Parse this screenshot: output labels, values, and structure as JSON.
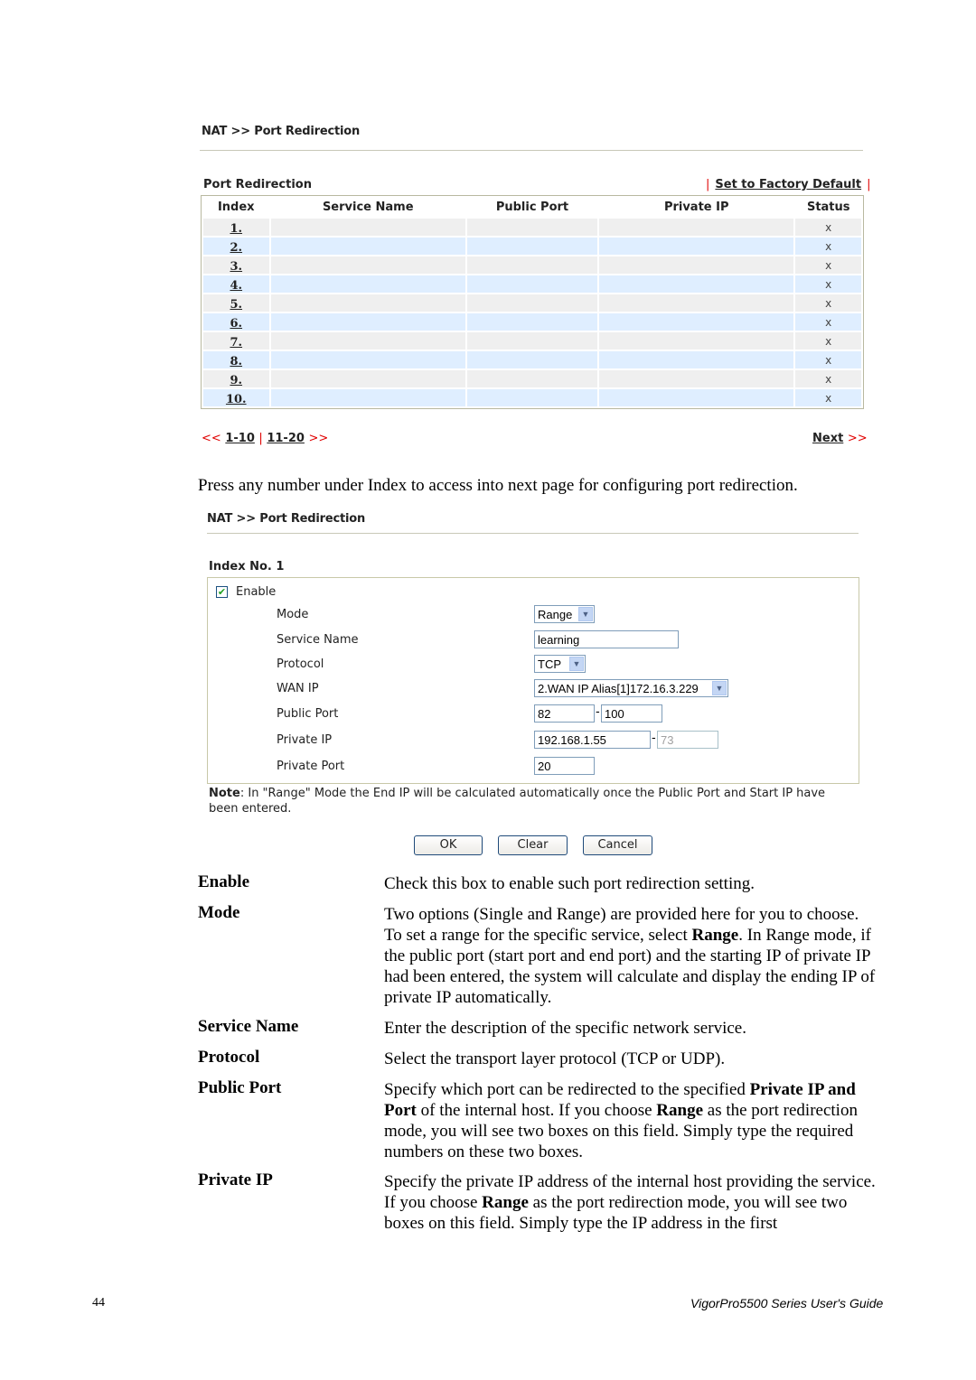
{
  "screen1": {
    "breadcrumb": "NAT >> Port Redirection",
    "section_title": "Port Redirection",
    "factory_default_link": "Set to Factory Default",
    "columns": [
      "Index",
      "Service Name",
      "Public Port",
      "Private IP",
      "Status"
    ],
    "rows": [
      {
        "index": "1.",
        "service_name": "",
        "public_port": "",
        "private_ip": "",
        "status": "x"
      },
      {
        "index": "2.",
        "service_name": "",
        "public_port": "",
        "private_ip": "",
        "status": "x"
      },
      {
        "index": "3.",
        "service_name": "",
        "public_port": "",
        "private_ip": "",
        "status": "x"
      },
      {
        "index": "4.",
        "service_name": "",
        "public_port": "",
        "private_ip": "",
        "status": "x"
      },
      {
        "index": "5.",
        "service_name": "",
        "public_port": "",
        "private_ip": "",
        "status": "x"
      },
      {
        "index": "6.",
        "service_name": "",
        "public_port": "",
        "private_ip": "",
        "status": "x"
      },
      {
        "index": "7.",
        "service_name": "",
        "public_port": "",
        "private_ip": "",
        "status": "x"
      },
      {
        "index": "8.",
        "service_name": "",
        "public_port": "",
        "private_ip": "",
        "status": "x"
      },
      {
        "index": "9.",
        "service_name": "",
        "public_port": "",
        "private_ip": "",
        "status": "x"
      },
      {
        "index": "10.",
        "service_name": "",
        "public_port": "",
        "private_ip": "",
        "status": "x"
      }
    ],
    "pager": {
      "prev": "<<",
      "range1": "1-10",
      "separator": "|",
      "range2": "11-20",
      "next_arrows": ">>",
      "next_label": "Next",
      "next_suffix": ">>"
    }
  },
  "instruction": "Press any number under Index to access into next page for configuring port redirection.",
  "screen2": {
    "breadcrumb": "NAT >> Port Redirection",
    "section_title": "Index No. 1",
    "enable_label": "Enable",
    "enable_checked": true,
    "fields": {
      "mode": {
        "label": "Mode",
        "value": "Range"
      },
      "service_name": {
        "label": "Service Name",
        "value": "learning"
      },
      "protocol": {
        "label": "Protocol",
        "value": "TCP"
      },
      "wan_ip": {
        "label": "WAN IP",
        "value": "2.WAN IP Alias[1]172.16.3.229"
      },
      "public_port": {
        "label": "Public Port",
        "start": "82",
        "end": "100"
      },
      "private_ip": {
        "label": "Private IP",
        "start": "192.168.1.55",
        "end": "73"
      },
      "private_port": {
        "label": "Private Port",
        "value": "20"
      }
    },
    "dash": "-",
    "note_label": "Note",
    "note_text": ": In \"Range\" Mode the End IP will be calculated automatically once the Public Port and Start IP have been entered.",
    "buttons": {
      "ok": "OK",
      "clear": "Clear",
      "cancel": "Cancel"
    }
  },
  "descriptions": [
    {
      "term": "Enable",
      "text": "Check this box to enable such port redirection setting."
    },
    {
      "term": "Mode",
      "parts": [
        "Two options (Single and Range) are provided here for you to choose. To set a range for the specific service, select ",
        "Range",
        ". In Range mode, if the public port (start port and end port) and the starting IP of private IP had been entered, the system will calculate and display the ending IP of private IP automatically."
      ]
    },
    {
      "term": "Service Name",
      "text": "Enter the description of the specific network service."
    },
    {
      "term": "Protocol",
      "text": "Select the transport layer protocol (TCP or UDP)."
    },
    {
      "term": "Public Port",
      "parts": [
        "Specify which port can be redirected to the specified ",
        "Private IP and Port",
        " of the internal host. If you choose ",
        "Range",
        " as the port redirection mode, you will see two boxes on this field. Simply type the required numbers on these two boxes."
      ]
    },
    {
      "term": "Private IP",
      "parts": [
        "Specify the private IP address of the internal host providing the service. If you choose ",
        "Range",
        " as the port redirection mode, you will see two boxes on this field. Simply type the IP address in the first"
      ]
    }
  ],
  "footer": {
    "page_number": "44",
    "guide_title": "VigorPro5500 Series User's Guide"
  }
}
